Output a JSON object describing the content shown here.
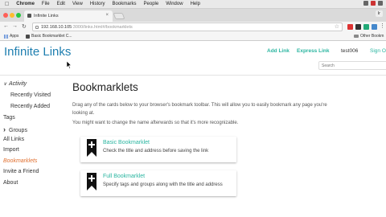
{
  "menubar": {
    "app": "Chrome",
    "items": [
      "File",
      "Edit",
      "View",
      "History",
      "Bookmarks",
      "People",
      "Window",
      "Help"
    ]
  },
  "browser": {
    "tab_title": "Infinite Links",
    "user_chip": "Ir",
    "url_host": "192.168.10.105",
    "url_path": ":3000/links.html#/bookmarklets"
  },
  "bookmarks_bar": {
    "apps_label": "Apps",
    "item_label": "Basic Bookmarklet C...",
    "other_label": "Other Bookm"
  },
  "header": {
    "brand": "Infinite Links",
    "add_link": "Add Link",
    "express_link": "Express Link",
    "username": "test006",
    "signout": "Sign O",
    "search_placeholder": "Search"
  },
  "sidebar": {
    "activity": "Activity",
    "recently_visited": "Recently Visited",
    "recently_added": "Recently Added",
    "tags": "Tags",
    "groups": "Groups",
    "all_links": "All Links",
    "import": "Import",
    "bookmarklets": "Bookmarklets",
    "invite": "Invite a Friend",
    "about": "About"
  },
  "main": {
    "title": "Bookmarklets",
    "line1": "Drag any of the cards below to your browser's bookmark toolbar. This will allow you to easily bookmark any page you're",
    "line2": "looking at.",
    "line3": "You might want to change the name afterwards so that it's more recognizable.",
    "cards": [
      {
        "title": "Basic Bookmarklet",
        "desc": "Check the title and address before saving the link"
      },
      {
        "title": "Full Bookmarklet",
        "desc": "Specify tags and groups along with the title and address"
      }
    ]
  },
  "colors": {
    "brand": "#1f7fb0",
    "accent": "#2ab5a0",
    "active_nav": "#e07030"
  }
}
